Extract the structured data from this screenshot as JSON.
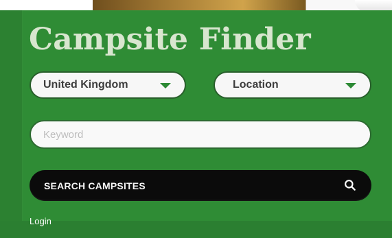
{
  "header": {
    "title": "Campsite Finder"
  },
  "filters": {
    "country": {
      "selected": "United Kingdom"
    },
    "location": {
      "selected": "Location"
    },
    "keyword": {
      "placeholder": "Keyword"
    }
  },
  "actions": {
    "search_label": "SEARCH CAMPSITES",
    "login_label": "Login"
  },
  "icons": {
    "dropdown": "chevron-down-icon",
    "search": "search-icon"
  },
  "colors": {
    "brand_green": "#2f8c35",
    "button_black": "#0b0b0b",
    "title_color": "#d8e6cf",
    "field_bg": "#f7f7f7"
  }
}
